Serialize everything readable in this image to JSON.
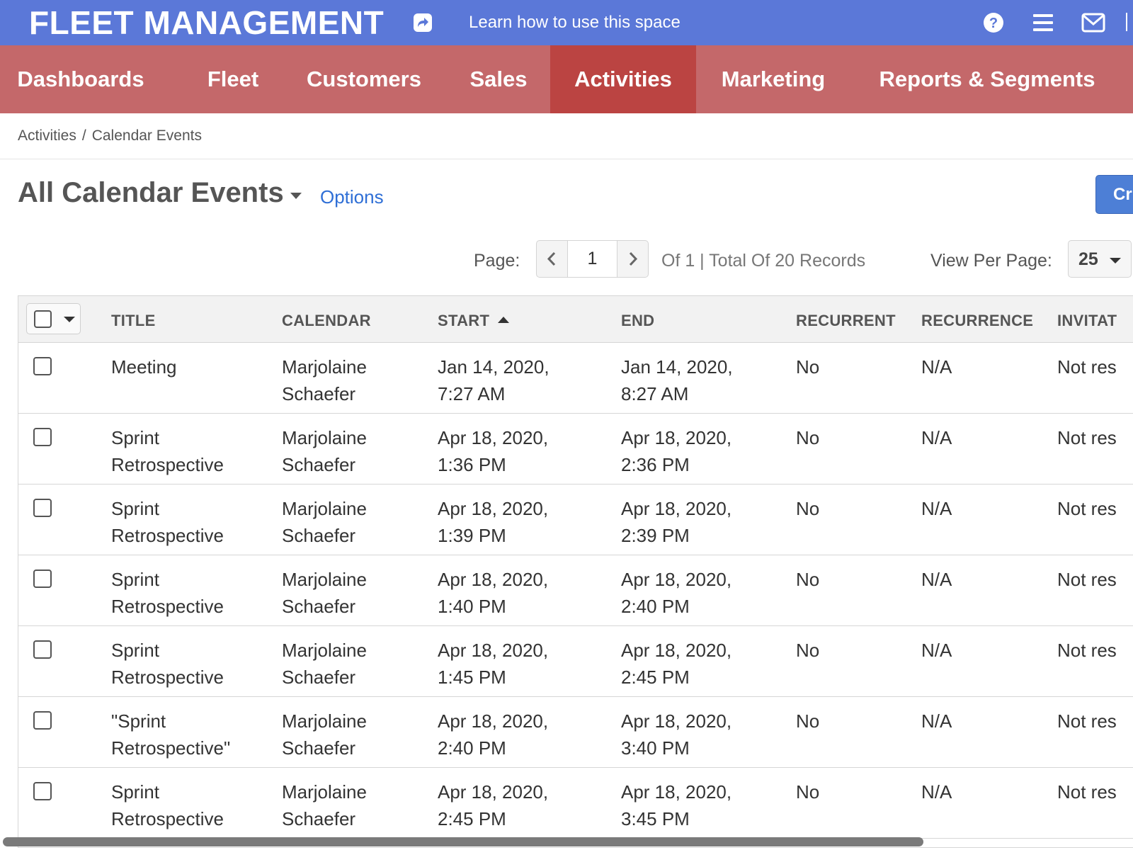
{
  "topbar": {
    "app_title": "FLEET MANAGEMENT",
    "learn_link": "Learn how to use this space",
    "brand_color": "#5b78d8",
    "icons": [
      "share-icon",
      "help-icon",
      "menu-icon",
      "mail-icon"
    ]
  },
  "nav": {
    "color": "#c4686a",
    "active_color": "#bb4442",
    "items": [
      {
        "label": "Dashboards"
      },
      {
        "label": "Fleet"
      },
      {
        "label": "Customers"
      },
      {
        "label": "Sales"
      },
      {
        "label": "Activities",
        "active": true
      },
      {
        "label": "Marketing"
      },
      {
        "label": "Reports & Segments"
      }
    ]
  },
  "breadcrumb": {
    "items": [
      "Activities",
      "Calendar Events"
    ],
    "separator": "/"
  },
  "heading": {
    "title": "All Calendar Events",
    "options_link": "Options",
    "create_button": "Cr"
  },
  "pagination": {
    "page_label": "Page:",
    "current_page": "1",
    "total_text": "Of 1 | Total Of 20 Records",
    "per_page_label": "View Per Page:",
    "per_page_value": "25"
  },
  "table": {
    "columns": [
      "TITLE",
      "CALENDAR",
      "START",
      "END",
      "RECURRENT",
      "RECURRENCE",
      "INVITAT"
    ],
    "sorted_column": "START",
    "sort_direction": "ascending",
    "rows": [
      {
        "title": [
          "Meeting",
          ""
        ],
        "calendar": [
          "Marjolaine",
          "Schaefer"
        ],
        "start": [
          "Jan 14, 2020,",
          "7:27 AM"
        ],
        "end": [
          "Jan 14, 2020,",
          "8:27 AM"
        ],
        "recurrent": "No",
        "recurrence": "N/A",
        "invitation": "Not res"
      },
      {
        "title": [
          "Sprint",
          "Retrospective"
        ],
        "calendar": [
          "Marjolaine",
          "Schaefer"
        ],
        "start": [
          "Apr 18, 2020,",
          "1:36 PM"
        ],
        "end": [
          "Apr 18, 2020,",
          "2:36 PM"
        ],
        "recurrent": "No",
        "recurrence": "N/A",
        "invitation": "Not res"
      },
      {
        "title": [
          "Sprint",
          "Retrospective"
        ],
        "calendar": [
          "Marjolaine",
          "Schaefer"
        ],
        "start": [
          "Apr 18, 2020,",
          "1:39 PM"
        ],
        "end": [
          "Apr 18, 2020,",
          "2:39 PM"
        ],
        "recurrent": "No",
        "recurrence": "N/A",
        "invitation": "Not res"
      },
      {
        "title": [
          "Sprint",
          "Retrospective"
        ],
        "calendar": [
          "Marjolaine",
          "Schaefer"
        ],
        "start": [
          "Apr 18, 2020,",
          "1:40 PM"
        ],
        "end": [
          "Apr 18, 2020,",
          "2:40 PM"
        ],
        "recurrent": "No",
        "recurrence": "N/A",
        "invitation": "Not res"
      },
      {
        "title": [
          "Sprint",
          "Retrospective"
        ],
        "calendar": [
          "Marjolaine",
          "Schaefer"
        ],
        "start": [
          "Apr 18, 2020,",
          "1:45 PM"
        ],
        "end": [
          "Apr 18, 2020,",
          "2:45 PM"
        ],
        "recurrent": "No",
        "recurrence": "N/A",
        "invitation": "Not res"
      },
      {
        "title": [
          "\"Sprint",
          "Retrospective\""
        ],
        "calendar": [
          "Marjolaine",
          "Schaefer"
        ],
        "start": [
          "Apr 18, 2020,",
          "2:40 PM"
        ],
        "end": [
          "Apr 18, 2020,",
          "3:40 PM"
        ],
        "recurrent": "No",
        "recurrence": "N/A",
        "invitation": "Not res"
      },
      {
        "title": [
          "Sprint",
          "Retrospective"
        ],
        "calendar": [
          "Marjolaine",
          "Schaefer"
        ],
        "start": [
          "Apr 18, 2020,",
          "2:45 PM"
        ],
        "end": [
          "Apr 18, 2020,",
          "3:45 PM"
        ],
        "recurrent": "No",
        "recurrence": "N/A",
        "invitation": "Not res"
      }
    ]
  }
}
